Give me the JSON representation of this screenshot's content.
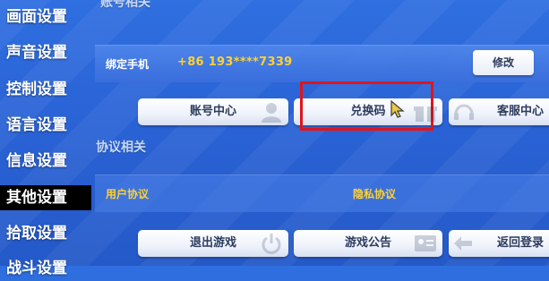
{
  "sidebar": {
    "items": [
      {
        "label": "画面设置",
        "active": false
      },
      {
        "label": "声音设置",
        "active": false
      },
      {
        "label": "控制设置",
        "active": false
      },
      {
        "label": "语言设置",
        "active": false
      },
      {
        "label": "信息设置",
        "active": false
      },
      {
        "label": "其他设置",
        "active": true
      },
      {
        "label": "拾取设置",
        "active": false
      },
      {
        "label": "战斗设置",
        "active": false
      }
    ]
  },
  "account_section": {
    "title": "账号相关",
    "bind_phone_label": "绑定手机",
    "phone": "+86 193****7339",
    "modify_button": "修改",
    "buttons": [
      {
        "label": "账号中心",
        "icon": "user-icon"
      },
      {
        "label": "兑换码",
        "icon": "gift-icon"
      },
      {
        "label": "客服中心",
        "icon": "headset-icon"
      }
    ]
  },
  "agreement_section": {
    "title": "协议相关",
    "user_agreement": "用户协议",
    "privacy_agreement": "隐私协议",
    "buttons": [
      {
        "label": "退出游戏",
        "icon": "power-icon"
      },
      {
        "label": "游戏公告",
        "icon": "id-card-icon"
      },
      {
        "label": "返回登录",
        "icon": "back-icon"
      }
    ]
  },
  "colors": {
    "accent_yellow": "#ffd22e",
    "highlight_red": "#e0141c",
    "background_blue": "#2a63d6"
  }
}
